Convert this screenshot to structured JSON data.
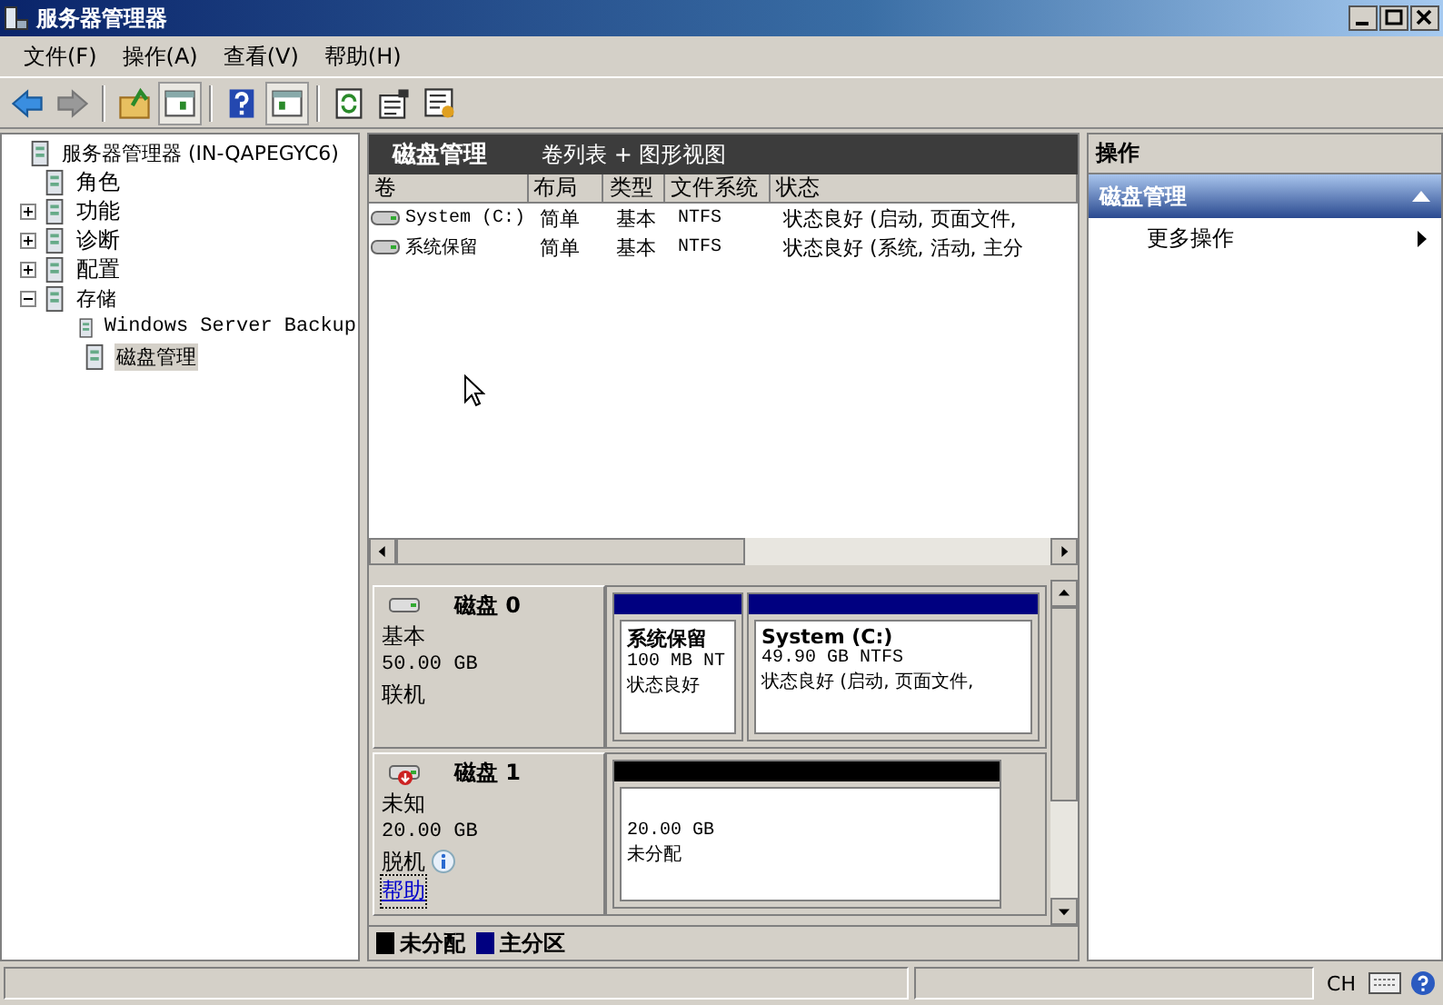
{
  "window": {
    "title": "服务器管理器"
  },
  "menu": [
    "文件(F)",
    "操作(A)",
    "查看(V)",
    "帮助(H)"
  ],
  "tree": [
    {
      "label": "服务器管理器 (IN-QAPEGYC6)",
      "selected": false,
      "children": [
        {
          "label": "角色",
          "selected": false
        },
        {
          "label": "功能",
          "expanded": false,
          "selected": false
        },
        {
          "label": "诊断",
          "expanded": false,
          "selected": false
        },
        {
          "label": "配置",
          "expanded": false,
          "selected": false
        },
        {
          "label": "存储",
          "expanded": true,
          "selected": false,
          "children": [
            {
              "label": "Windows Server Backup",
              "selected": false
            },
            {
              "label": "磁盘管理",
              "selected": true
            }
          ]
        }
      ]
    }
  ],
  "center": {
    "title": "磁盘管理",
    "view": "卷列表 + 图形视图"
  },
  "volumes": {
    "columns": [
      "卷",
      "布局",
      "类型",
      "文件系统",
      "状态"
    ],
    "rows": [
      [
        "System (C:)",
        "简单",
        "基本",
        "NTFS",
        "状态良好 (启动, 页面文件,"
      ],
      [
        "系统保留",
        "简单",
        "基本",
        "NTFS",
        "状态良好 (系统, 活动, 主分"
      ]
    ]
  },
  "disks": [
    {
      "name": "磁盘 0",
      "type": "基本",
      "size": "50.00 GB",
      "status": "联机",
      "online": true,
      "partitions": [
        {
          "name": "系统保留",
          "size": "100 MB NT",
          "status": "状态良好",
          "color": "#000080"
        },
        {
          "name": "System (C:)",
          "size": "49.90 GB NTFS",
          "status": "状态良好 (启动, 页面文件,",
          "color": "#000080"
        }
      ]
    },
    {
      "name": "磁盘 1",
      "type": "未知",
      "size": "20.00 GB",
      "status": "脱机",
      "online": false,
      "link": "帮助",
      "partitions": [
        {
          "size": "20.00 GB",
          "status": "未分配",
          "color": "#000000"
        }
      ]
    }
  ],
  "legend": [
    {
      "label": "未分配",
      "color": "#000000"
    },
    {
      "label": "主分区",
      "color": "#000080"
    }
  ],
  "actions": {
    "title": "操作",
    "section": "磁盘管理",
    "items": [
      "更多操作"
    ]
  },
  "status_bar": {
    "language": "CH"
  }
}
